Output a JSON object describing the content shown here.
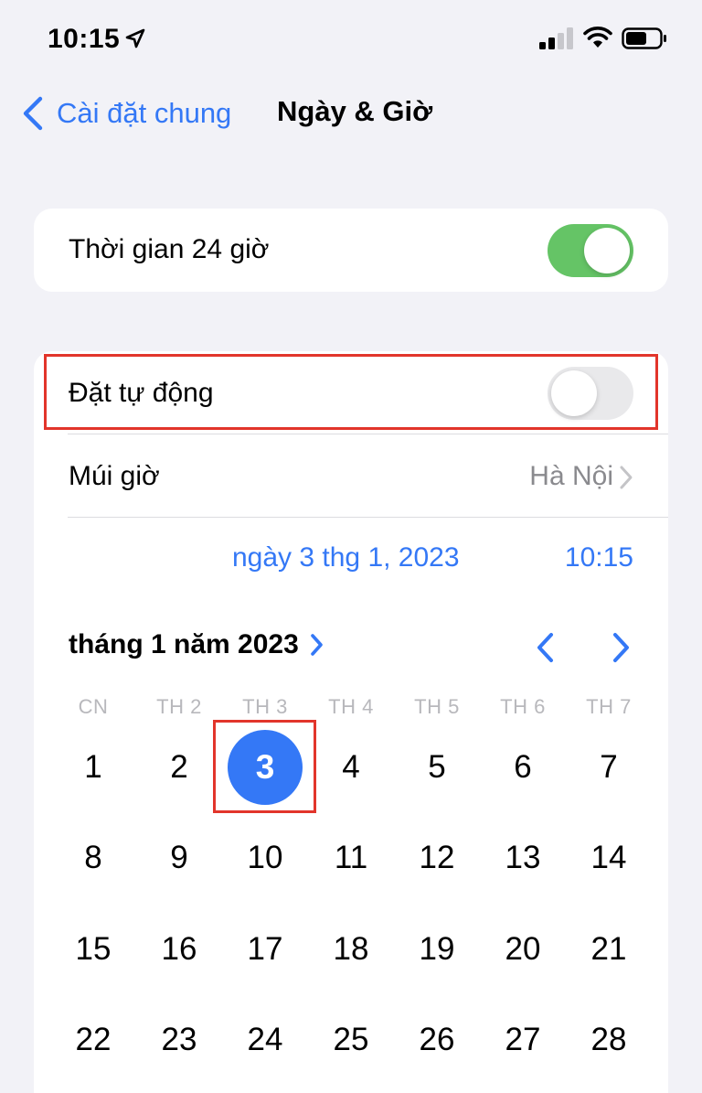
{
  "status_bar": {
    "time": "10:15"
  },
  "nav": {
    "back_label": "Cài đặt chung",
    "title": "Ngày & Giờ"
  },
  "settings": {
    "time_24h": {
      "label": "Thời gian 24 giờ",
      "enabled": true
    },
    "auto_set": {
      "label": "Đặt tự động",
      "enabled": false
    },
    "time_zone": {
      "label": "Múi giờ",
      "value": "Hà Nội"
    },
    "date_value": "ngày 3 thg 1, 2023",
    "time_value": "10:15"
  },
  "calendar": {
    "month_title": "tháng 1 năm 2023",
    "weekdays": [
      "CN",
      "TH 2",
      "TH 3",
      "TH 4",
      "TH 5",
      "TH 6",
      "TH 7"
    ],
    "days": [
      "1",
      "2",
      "3",
      "4",
      "5",
      "6",
      "7",
      "8",
      "9",
      "10",
      "11",
      "12",
      "13",
      "14",
      "15",
      "16",
      "17",
      "18",
      "19",
      "20",
      "21",
      "22",
      "23",
      "24",
      "25",
      "26",
      "27",
      "28"
    ],
    "selected_day": "3"
  },
  "colors": {
    "accent": "#3478f6",
    "toggle_on": "#65c466",
    "toggle_off": "#e9e9eb",
    "highlight": "#e2352b",
    "background": "#f2f2f7"
  }
}
